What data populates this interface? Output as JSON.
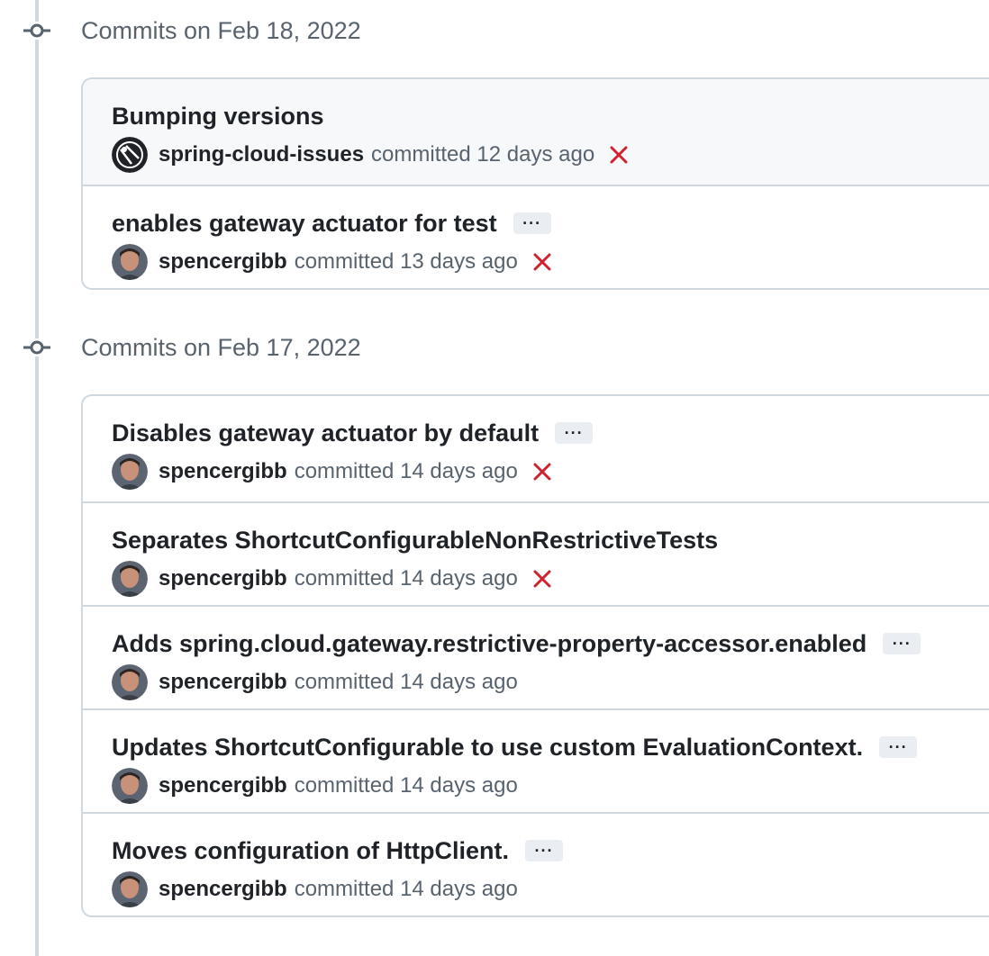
{
  "colors": {
    "failure": "#cf222e",
    "border": "#d0d7de",
    "muted_text": "#59636e",
    "title_text": "#1f2328"
  },
  "icons": {
    "timeline_node": "git-commit-icon",
    "status_failed": "x-icon",
    "more": "ellipsis-icon"
  },
  "groups": [
    {
      "title": "Commits on Feb 18, 2022",
      "commits": [
        {
          "title": "Bumping versions",
          "author": "spring-cloud-issues",
          "time": "committed 12 days ago",
          "status": "failed",
          "has_more": false,
          "avatar": "bot"
        },
        {
          "title": "enables gateway actuator for test",
          "author": "spencergibb",
          "time": "committed 13 days ago",
          "status": "failed",
          "has_more": true,
          "avatar": "person"
        }
      ]
    },
    {
      "title": "Commits on Feb 17, 2022",
      "commits": [
        {
          "title": "Disables gateway actuator by default",
          "author": "spencergibb",
          "time": "committed 14 days ago",
          "status": "failed",
          "has_more": true,
          "avatar": "person"
        },
        {
          "title": "Separates ShortcutConfigurableNonRestrictiveTests",
          "author": "spencergibb",
          "time": "committed 14 days ago",
          "status": "failed",
          "has_more": false,
          "avatar": "person"
        },
        {
          "title": "Adds spring.cloud.gateway.restrictive-property-accessor.enabled",
          "author": "spencergibb",
          "time": "committed 14 days ago",
          "status": "none",
          "has_more": true,
          "avatar": "person"
        },
        {
          "title": "Updates ShortcutConfigurable to use custom EvaluationContext.",
          "author": "spencergibb",
          "time": "committed 14 days ago",
          "status": "none",
          "has_more": true,
          "avatar": "person"
        },
        {
          "title": "Moves configuration of HttpClient.",
          "author": "spencergibb",
          "time": "committed 14 days ago",
          "status": "none",
          "has_more": true,
          "avatar": "person"
        }
      ]
    }
  ]
}
